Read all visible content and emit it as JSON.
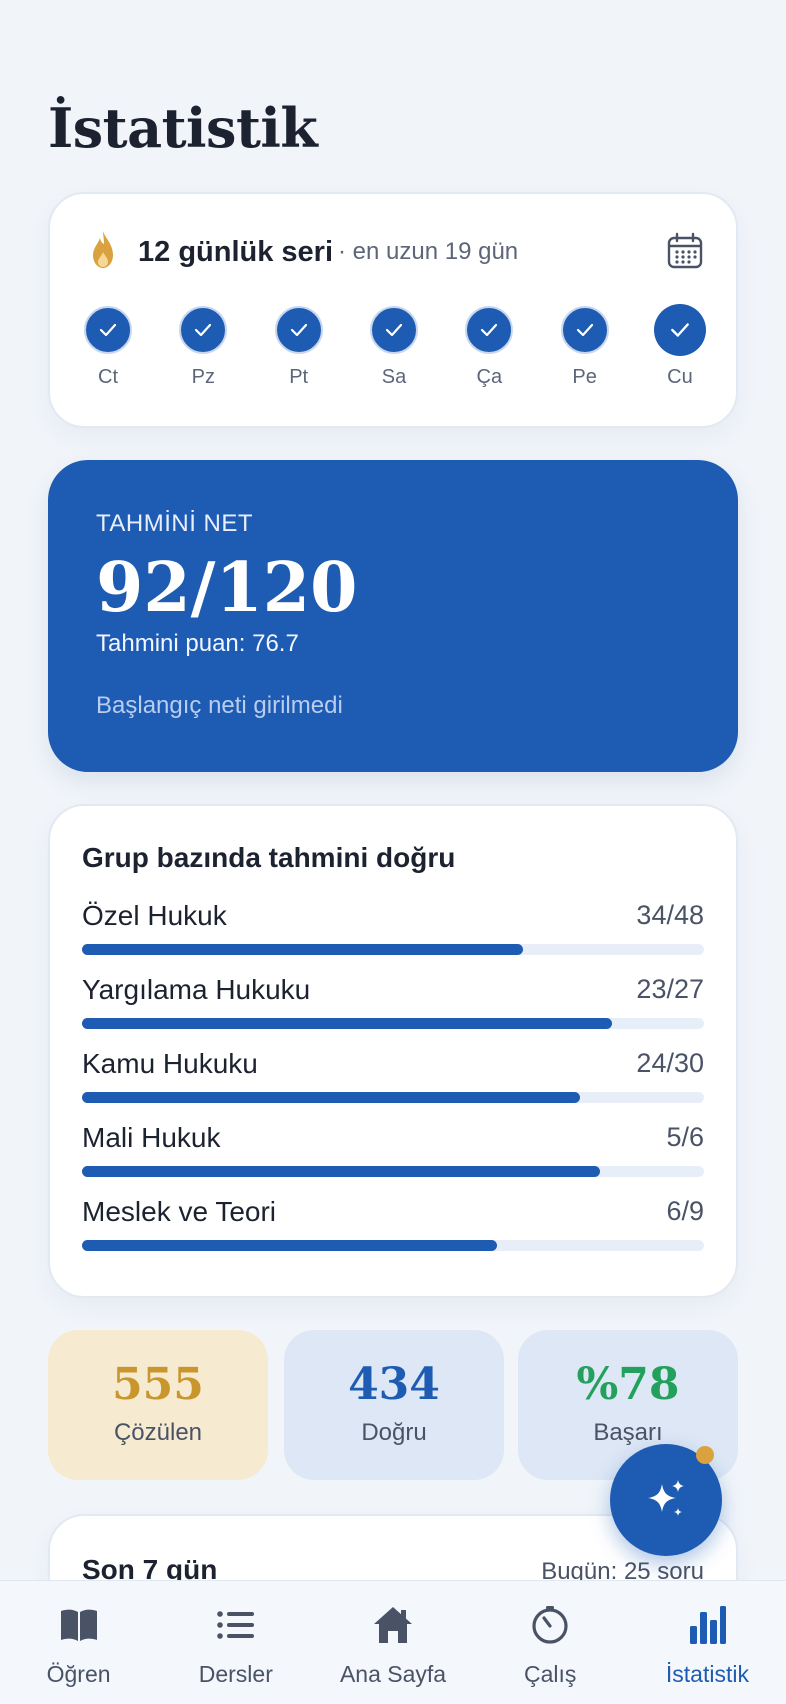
{
  "page": {
    "title": "İstatistik"
  },
  "streak": {
    "title": "12 günlük seri",
    "subtitle": "· en uzun 19 gün",
    "days": [
      {
        "label": "Ct",
        "done": true,
        "today": false
      },
      {
        "label": "Pz",
        "done": true,
        "today": false
      },
      {
        "label": "Pt",
        "done": true,
        "today": false
      },
      {
        "label": "Sa",
        "done": true,
        "today": false
      },
      {
        "label": "Ça",
        "done": true,
        "today": false
      },
      {
        "label": "Pe",
        "done": true,
        "today": false
      },
      {
        "label": "Cu",
        "done": true,
        "today": true
      }
    ]
  },
  "net": {
    "label": "TAHMİNİ NET",
    "value": "92/120",
    "puan": "Tahmini puan: 76.7",
    "note": "Başlangıç neti girilmedi"
  },
  "groups": {
    "title": "Grup bazında tahmini doğru",
    "items": [
      {
        "name": "Özel Hukuk",
        "score": "34/48",
        "correct": 34,
        "total": 48
      },
      {
        "name": "Yargılama Hukuku",
        "score": "23/27",
        "correct": 23,
        "total": 27
      },
      {
        "name": "Kamu Hukuku",
        "score": "24/30",
        "correct": 24,
        "total": 30
      },
      {
        "name": "Mali Hukuk",
        "score": "5/6",
        "correct": 5,
        "total": 6
      },
      {
        "name": "Meslek ve Teori",
        "score": "6/9",
        "correct": 6,
        "total": 9
      }
    ]
  },
  "stats": {
    "solved": {
      "value": "555",
      "label": "Çözülen"
    },
    "correct": {
      "value": "434",
      "label": "Doğru"
    },
    "success": {
      "value": "%78",
      "label": "Başarı"
    }
  },
  "week": {
    "title": "Son 7 gün",
    "today": "Bugün: 25 soru"
  },
  "nav": {
    "items": [
      {
        "label": "Öğren",
        "icon": "book-icon"
      },
      {
        "label": "Dersler",
        "icon": "list-icon"
      },
      {
        "label": "Ana Sayfa",
        "icon": "home-icon"
      },
      {
        "label": "Çalış",
        "icon": "timer-icon"
      },
      {
        "label": "İstatistik",
        "icon": "bar-chart-icon"
      }
    ],
    "active": "İstatistik"
  },
  "colors": {
    "primary": "#1e5cb3",
    "accent_gold": "#c9962e",
    "success_green": "#23a05c",
    "background": "#f1f5fa"
  }
}
